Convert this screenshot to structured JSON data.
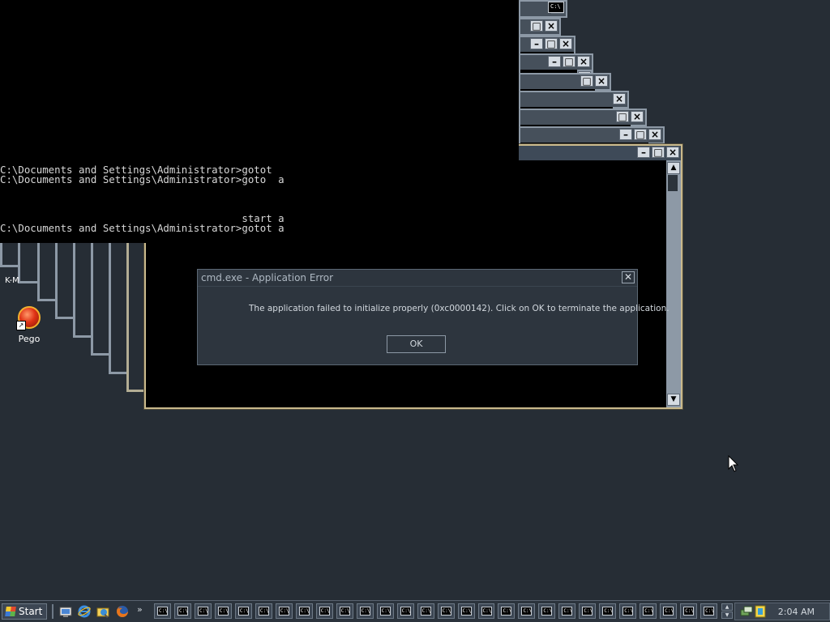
{
  "console": {
    "lines": [
      "C:\\Documents and Settings\\Administrator>gotot",
      "C:\\Documents and Settings\\Administrator>goto  a",
      "                                        start a",
      "C:\\Documents and Settings\\Administrator>gotot a"
    ]
  },
  "cascade_title_icon": "C:\\",
  "desktop": {
    "icons": [
      {
        "label": "Pego",
        "icon": "pego-icon"
      },
      {
        "label": "K-M",
        "icon": "partial-icon"
      }
    ]
  },
  "dialog": {
    "title": "cmd.exe - Application Error",
    "message": "The application failed to initialize properly (0xc0000142). Click on OK to terminate the application.",
    "ok_label": "OK",
    "close_glyph": "✕"
  },
  "taskbar": {
    "start_label": "Start",
    "quick_launch": [
      "desktop-icon",
      "ie-icon",
      "explorer-icon",
      "firefox-icon"
    ],
    "overflow": "»",
    "task_label": "C:\\",
    "task_count": 28,
    "clock": "2:04 AM"
  },
  "colors": {
    "desktop": "#262d35",
    "active_border": "#c9b98c",
    "frame": "#8d99a6"
  }
}
